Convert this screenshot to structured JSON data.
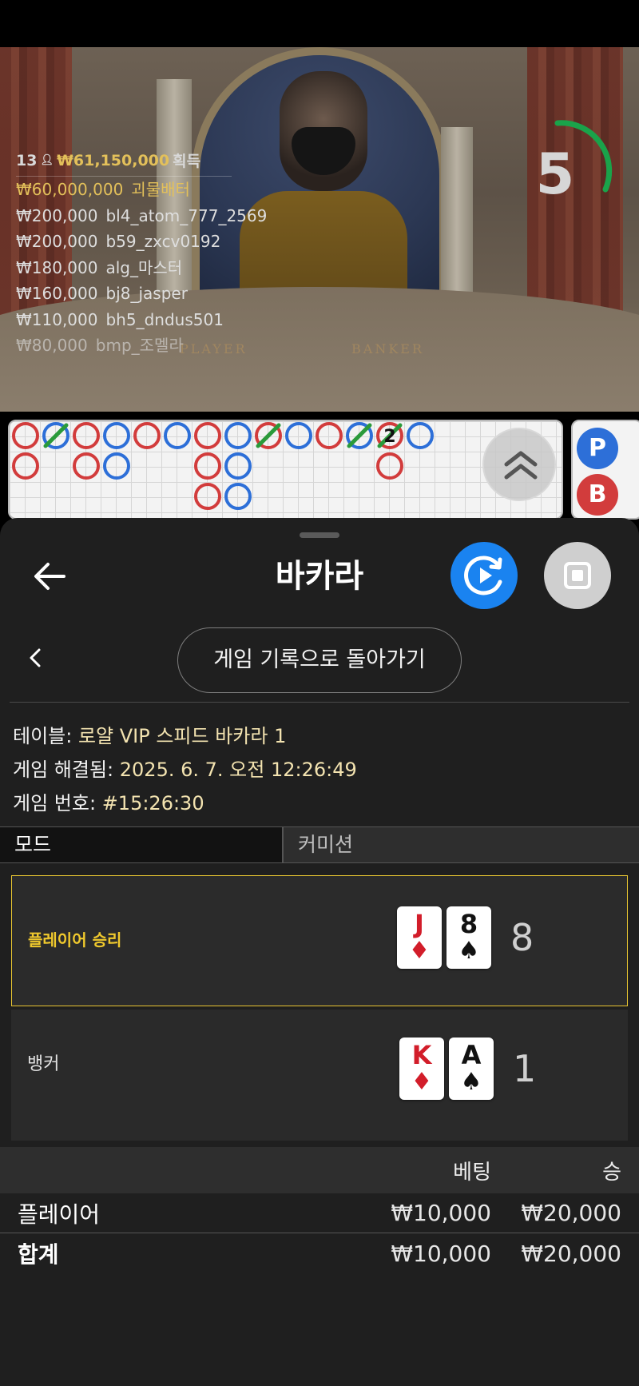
{
  "video": {
    "winners_header": {
      "count": "13",
      "total": "₩61,150,000",
      "suffix": "획득"
    },
    "winners": [
      {
        "amount": "₩60,000,000",
        "name": "괴물배터"
      },
      {
        "amount": "₩200,000",
        "name": "bl4_atom_777_2569"
      },
      {
        "amount": "₩200,000",
        "name": "b59_zxcv0192"
      },
      {
        "amount": "₩180,000",
        "name": "alg_마스터"
      },
      {
        "amount": "₩160,000",
        "name": "bj8_jasper"
      },
      {
        "amount": "₩110,000",
        "name": "bh5_dndus501"
      },
      {
        "amount": "₩80,000",
        "name": "bmp_조멜라"
      }
    ],
    "felt_player": "PLAYER",
    "felt_banker": "BANKER",
    "countdown": "5"
  },
  "road": {
    "marker_number": "2",
    "side_p": "P",
    "side_b": "B",
    "colors": {
      "banker": "#d23c3c",
      "player": "#2d6fd8",
      "tie": "#2a9a3a"
    }
  },
  "sheet": {
    "title": "바카라",
    "history_button": "게임 기록으로 돌아가기",
    "info": {
      "table_label": "테이블:",
      "table_value": "로얄 VIP 스피드 바카라 1",
      "resolved_label": "게임 해결됨:",
      "resolved_value": "2025. 6. 7. 오전 12:26:49",
      "number_label": "게임 번호:",
      "number_value": "#15:26:30"
    },
    "tabs": {
      "mode": "모드",
      "commission": "커미션"
    },
    "results": {
      "player": {
        "label": "플레이어 승리",
        "cards": [
          {
            "rank": "J",
            "suit": "♦"
          },
          {
            "rank": "8",
            "suit": "♠"
          }
        ],
        "score": "8"
      },
      "banker": {
        "label": "뱅커",
        "cards": [
          {
            "rank": "K",
            "suit": "♦"
          },
          {
            "rank": "A",
            "suit": "♠"
          }
        ],
        "score": "1"
      }
    },
    "totals": {
      "head_bet": "베팅",
      "head_win": "승",
      "rows": [
        {
          "label": "플레이어",
          "bet": "₩10,000",
          "win": "₩20,000"
        },
        {
          "label": "합계",
          "bet": "₩10,000",
          "win": "₩20,000"
        }
      ]
    },
    "accent_colors": {
      "win_border": "#e8c531",
      "replay_button": "#1a83f0"
    }
  }
}
